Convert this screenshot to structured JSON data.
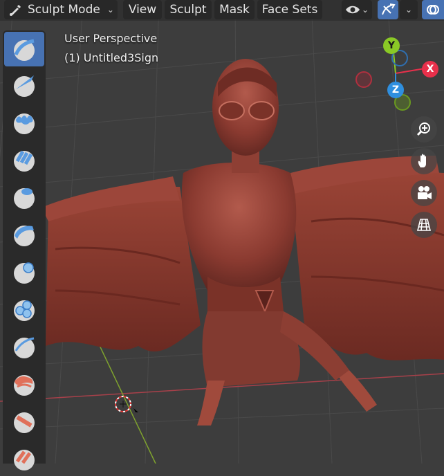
{
  "header": {
    "mode_label": "Sculpt Mode",
    "menus": [
      "View",
      "Sculpt",
      "Mask",
      "Face Sets"
    ],
    "icons": [
      "brush-icon",
      "chevron-down-icon",
      "eye-icon",
      "gizmo-icon",
      "overlay-icon"
    ]
  },
  "overlay": {
    "perspective": "User Perspective",
    "object": "(1) Untitled3Sign"
  },
  "gizmo": {
    "x": "X",
    "y": "Y",
    "z": "Z",
    "colors": {
      "x": "#e8304b",
      "y": "#8ac926",
      "z": "#2f8fdf"
    }
  },
  "nav_buttons": [
    "zoom-icon",
    "hand-pan-icon",
    "camera-icon",
    "perspective-grid-icon"
  ],
  "toolbar": {
    "tools": [
      "draw",
      "draw-sharp",
      "clay",
      "clay-strips",
      "clay-thumb",
      "layer",
      "inflate",
      "blob",
      "crease",
      "smooth",
      "flatten",
      "fill"
    ],
    "active_index": 0
  }
}
